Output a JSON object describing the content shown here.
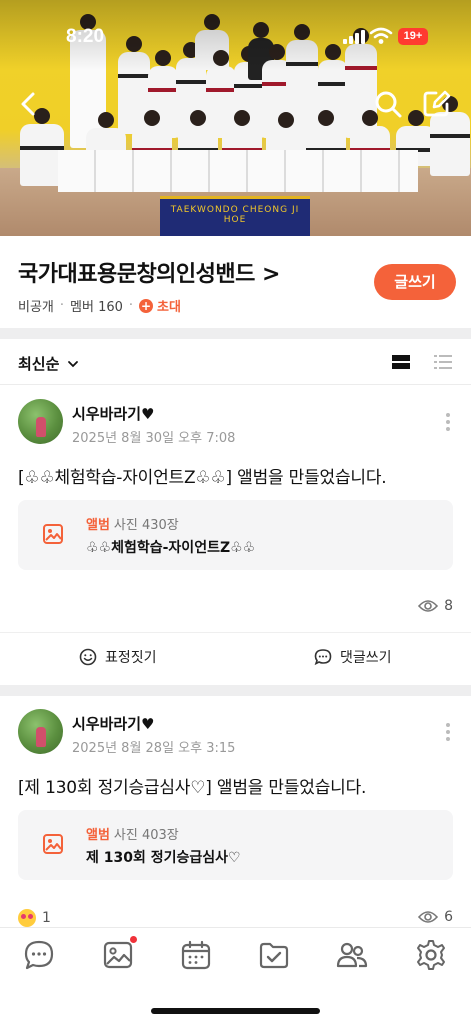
{
  "status_bar": {
    "time": "8:20",
    "battery": "19+"
  },
  "cover": {
    "banner_text": "TAEKWONDO CHEONG JI HOE"
  },
  "band": {
    "title": "국가대표용문창의인성밴드 >",
    "privacy": "비공개",
    "members": "멤버 160",
    "invite": "초대",
    "write_button": "글쓰기"
  },
  "sort": {
    "label": "최신순"
  },
  "posts": [
    {
      "author": "시우바라기♥",
      "date": "2025년 8월 30일 오후 7:08",
      "text": "[♧♧체험학습-자이언트Z♧♧] 앨범을 만들었습니다.",
      "album_label": "앨범",
      "album_count": "사진 430장",
      "album_title": "♧♧체험학습-자이언트Z♧♧",
      "views": "8",
      "actions": {
        "react": "표정짓기",
        "comment": "댓글쓰기"
      }
    },
    {
      "author": "시우바라기♥",
      "date": "2025년 8월 28일 오후 3:15",
      "text": "[제 130회 정기승급심사♡] 앨범을 만들었습니다.",
      "album_label": "앨범",
      "album_count": "사진 403장",
      "album_title": "제 130회 정기승급심사♡",
      "reactions": "1",
      "views": "6"
    }
  ],
  "tabbar": {
    "items": [
      "chat-icon",
      "photo-icon",
      "calendar-icon",
      "folder-check-icon",
      "members-icon",
      "settings-icon"
    ],
    "accent": "#f4623a"
  }
}
